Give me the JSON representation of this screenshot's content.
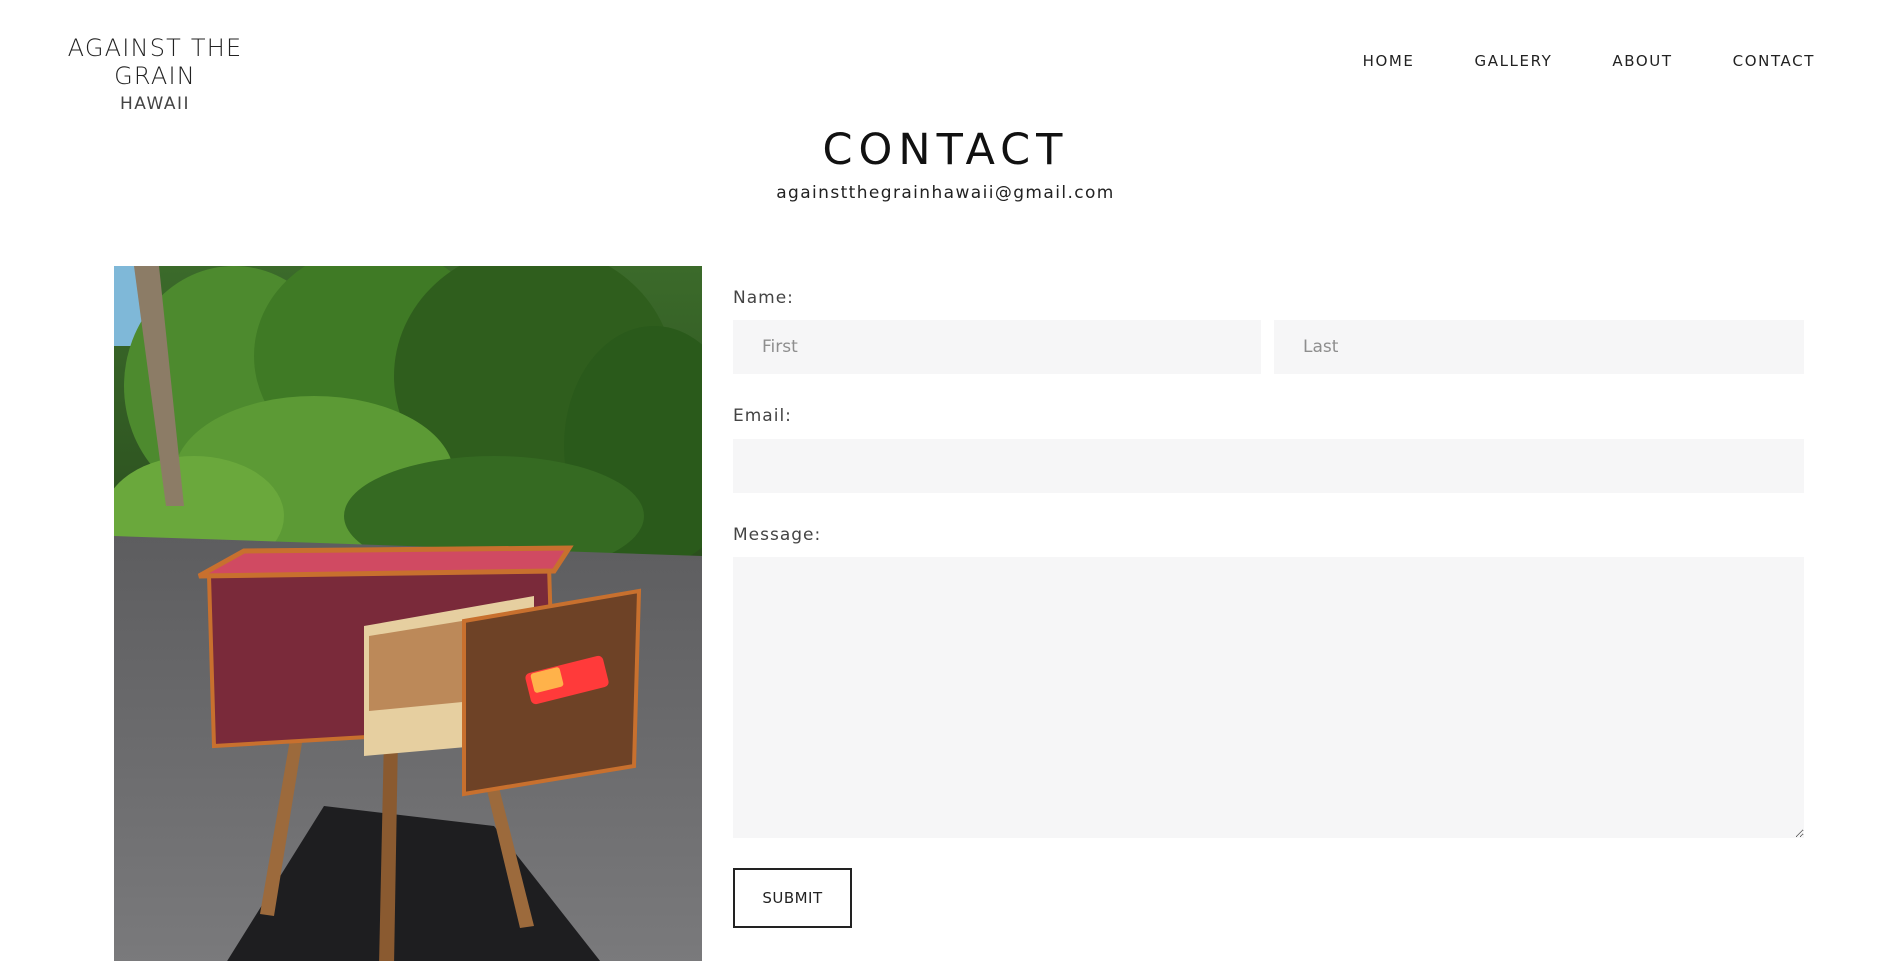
{
  "site": {
    "logo_title": "AGAINST THE GRAIN",
    "logo_subtitle": "HAWAII"
  },
  "nav": {
    "items": [
      {
        "label": "HOME"
      },
      {
        "label": "GALLERY"
      },
      {
        "label": "ABOUT"
      },
      {
        "label": "CONTACT"
      }
    ]
  },
  "main": {
    "title": "CONTACT",
    "email": "againstthegrainhawaii@gmail.com"
  },
  "form": {
    "name_label": "Name:",
    "first_placeholder": "First",
    "last_placeholder": "Last",
    "email_label": "Email:",
    "message_label": "Message:",
    "submit_label": "SUBMIT"
  },
  "colors": {
    "background": "#ffffff",
    "field_background": "#f6f6f7",
    "text": "#222222"
  }
}
